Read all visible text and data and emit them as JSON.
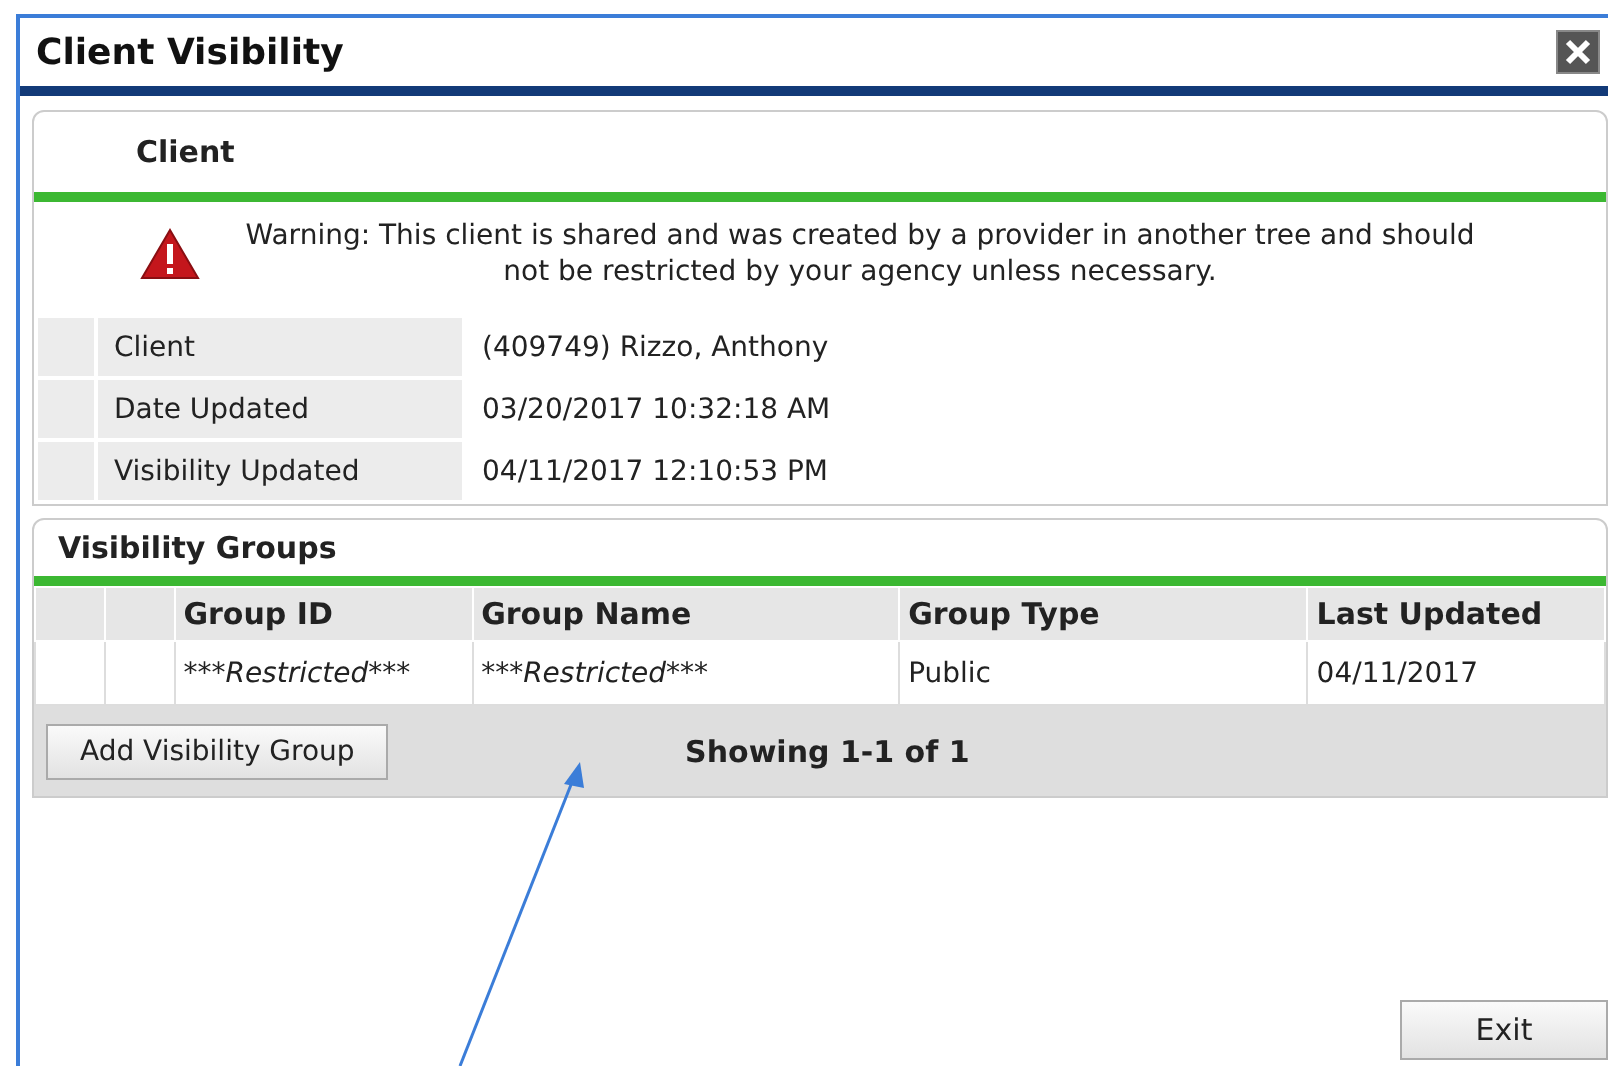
{
  "window": {
    "title": "Client Visibility"
  },
  "client_panel": {
    "title": "Client",
    "warning": "Warning: This client is shared and was created by a provider in another tree and should not be restricted by your agency unless necessary.",
    "fields": [
      {
        "label": "Client",
        "value": "(409749) Rizzo, Anthony"
      },
      {
        "label": "Date Updated",
        "value": "03/20/2017 10:32:18 AM"
      },
      {
        "label": "Visibility Updated",
        "value": "04/11/2017 12:10:53 PM"
      }
    ]
  },
  "groups_panel": {
    "title": "Visibility Groups",
    "columns": [
      "Group ID",
      "Group Name",
      "Group Type",
      "Last Updated"
    ],
    "rows": [
      {
        "cells": [
          {
            "text": "***Restricted***",
            "italic": true
          },
          {
            "text": "***Restricted***",
            "italic": true
          },
          {
            "text": "Public",
            "italic": false
          },
          {
            "text": "04/11/2017",
            "italic": false
          }
        ]
      }
    ],
    "add_button": "Add Visibility Group",
    "paging": "Showing 1-1 of 1"
  },
  "buttons": [
    "Exit"
  ]
}
